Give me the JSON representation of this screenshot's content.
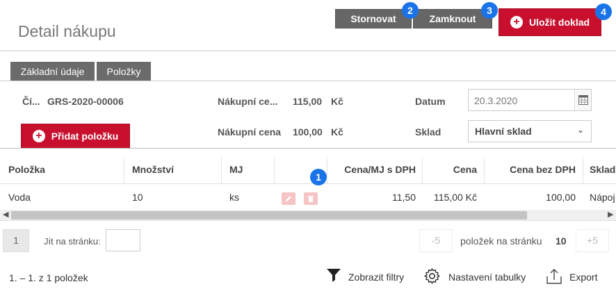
{
  "header": {
    "title": "Detail nákupu",
    "cancel_label": "Stornovat",
    "lock_label": "Zamknout",
    "save_label": "Uložit doklad"
  },
  "badges": {
    "b1": "1",
    "b2": "2",
    "b3": "3",
    "b4": "4"
  },
  "tabs": [
    {
      "label": "Základní údaje"
    },
    {
      "label": "Položky"
    }
  ],
  "form": {
    "number_label": "Čí...",
    "number_value": "GRS-2020-00006",
    "purchase_price_vat_label": "Nákupní ce...",
    "purchase_price_vat_value": "115,00",
    "purchase_price_vat_currency": "Kč",
    "purchase_price_label": "Nákupní cena",
    "purchase_price_value": "100,00",
    "purchase_price_currency": "Kč",
    "date_label": "Datum",
    "date_value": "20.3.2020",
    "warehouse_label": "Sklad",
    "warehouse_value": "Hlavní sklad",
    "add_item_label": "Přidat položku"
  },
  "table": {
    "columns": [
      "Položka",
      "Množství",
      "MJ",
      "Cena/MJ s DPH",
      "Cena",
      "Cena bez DPH",
      "Sklad"
    ],
    "rows": [
      {
        "item": "Voda",
        "qty": "10",
        "unit": "ks",
        "unit_price_vat": "11,50",
        "price": "115,00 Kč",
        "price_no_vat": "100,00",
        "warehouse": "Nápoj"
      }
    ]
  },
  "pager": {
    "current_page": "1",
    "goto_label": "Jít na stránku:",
    "minus_label": "-5",
    "per_page_label": "položek na stránku",
    "per_page_value": "10",
    "plus_label": "+5"
  },
  "footer": {
    "summary": "1. – 1. z 1 položek",
    "filters_label": "Zobrazit filtry",
    "settings_label": "Nastavení tabulky",
    "export_label": "Export"
  },
  "colors": {
    "accent_red": "#c8102e",
    "badge_blue": "#1a73e8",
    "dark_button": "#666666"
  }
}
